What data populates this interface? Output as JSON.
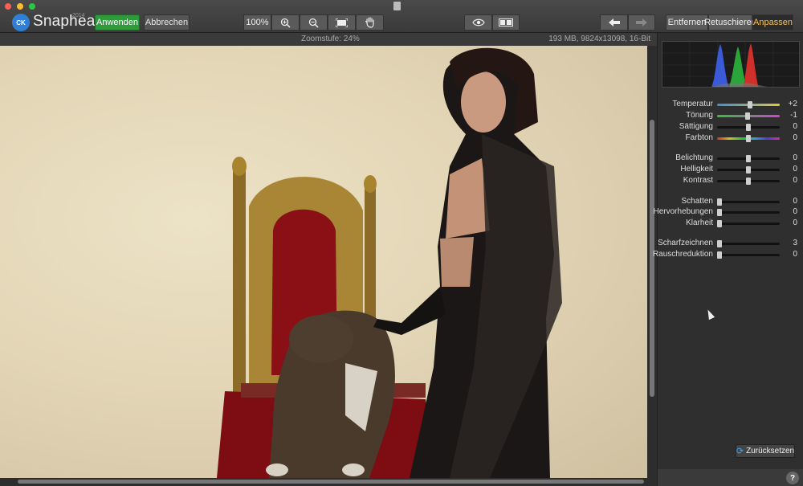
{
  "app": {
    "logo_badge": "CK",
    "name": "Snapheal",
    "year": "2014"
  },
  "toolbar": {
    "apply_label": "Anwenden",
    "cancel_label": "Abbrechen",
    "zoom_100_label": "100%",
    "modes": [
      {
        "label": "Entfernen",
        "active": false
      },
      {
        "label": "Retuschieren",
        "active": false
      },
      {
        "label": "Anpassen",
        "active": true
      }
    ]
  },
  "infobar": {
    "zoom_text": "Zoomstufe: 24%",
    "file_info": "193 MB, 9824x13098, 16-Bit"
  },
  "adjustments": [
    {
      "label": "Temperatur",
      "value": "+2",
      "level": 0.52,
      "track": "temperature"
    },
    {
      "label": "Tönung",
      "value": "-1",
      "level": 0.49,
      "track": "tint"
    },
    {
      "label": "Sättigung",
      "value": "0",
      "level": 0.5,
      "track": "dark"
    },
    {
      "label": "Farbton",
      "value": "0",
      "level": 0.5,
      "track": "hue"
    },
    {
      "label": "Belichtung",
      "value": "0",
      "level": 0.5,
      "track": "dark"
    },
    {
      "label": "Helligkeit",
      "value": "0",
      "level": 0.5,
      "track": "dark"
    },
    {
      "label": "Kontrast",
      "value": "0",
      "level": 0.5,
      "track": "dark"
    },
    {
      "label": "Schatten",
      "value": "0",
      "level": 0.0,
      "track": "dark"
    },
    {
      "label": "Hervorhebungen",
      "value": "0",
      "level": 0.0,
      "track": "dark"
    },
    {
      "label": "Klarheit",
      "value": "0",
      "level": 0.0,
      "track": "dark"
    },
    {
      "label": "Scharfzeichnen",
      "value": "3",
      "level": 0.03,
      "track": "dark"
    },
    {
      "label": "Rauschreduktion",
      "value": "0",
      "level": 0.0,
      "track": "dark"
    }
  ],
  "reset_label": "Zurücksetzen",
  "help_label": "?",
  "colors": {
    "accent_active": "#f5c05a",
    "apply_green": "#2e9b3a",
    "histogram_red": "#d0302a",
    "histogram_green": "#2aa53a",
    "histogram_blue": "#3a5ad8"
  }
}
